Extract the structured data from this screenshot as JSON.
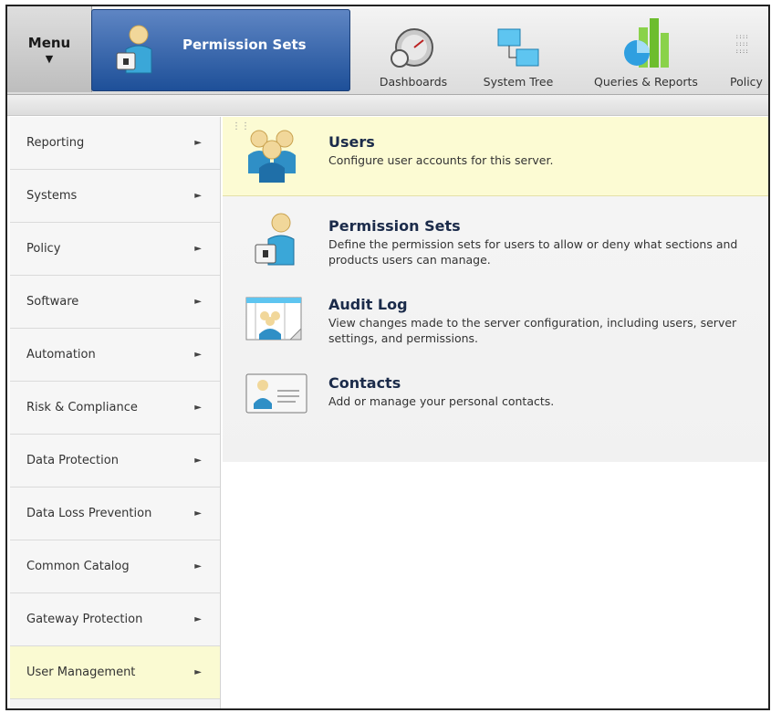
{
  "toolbar": {
    "menu_label": "Menu",
    "menu_arrow": "▼",
    "active_title": "Permission Sets",
    "items": [
      {
        "label": "Dashboards",
        "icon": "dashboard-gauge-icon"
      },
      {
        "label": "System Tree",
        "icon": "system-tree-icon"
      },
      {
        "label": "Queries & Reports",
        "icon": "queries-reports-icon"
      },
      {
        "label": "Policy",
        "icon": "policy-icon"
      }
    ]
  },
  "sidebar": {
    "items": [
      {
        "label": "Reporting"
      },
      {
        "label": "Systems"
      },
      {
        "label": "Policy"
      },
      {
        "label": "Software"
      },
      {
        "label": "Automation"
      },
      {
        "label": "Risk & Compliance"
      },
      {
        "label": "Data Protection"
      },
      {
        "label": "Data Loss Prevention"
      },
      {
        "label": "Common Catalog"
      },
      {
        "label": "Gateway Protection"
      },
      {
        "label": "User Management",
        "active": true
      }
    ],
    "chevron": "►"
  },
  "entries": [
    {
      "title": "Users",
      "desc": "Configure user accounts for this server.",
      "icon": "users-group-icon"
    },
    {
      "title": "Permission Sets",
      "desc": "Define the permission sets for users to allow or deny what sections and products users can manage.",
      "icon": "user-lock-icon"
    },
    {
      "title": "Audit Log",
      "desc": "View changes made to the server configuration, including users, server settings, and permissions.",
      "icon": "audit-log-icon"
    },
    {
      "title": "Contacts",
      "desc": "Add or manage your personal contacts.",
      "icon": "contact-card-icon"
    }
  ],
  "colors": {
    "active_tile": "#1d4f98",
    "highlight": "#fcfbd3",
    "title_text": "#1b2b4a"
  }
}
